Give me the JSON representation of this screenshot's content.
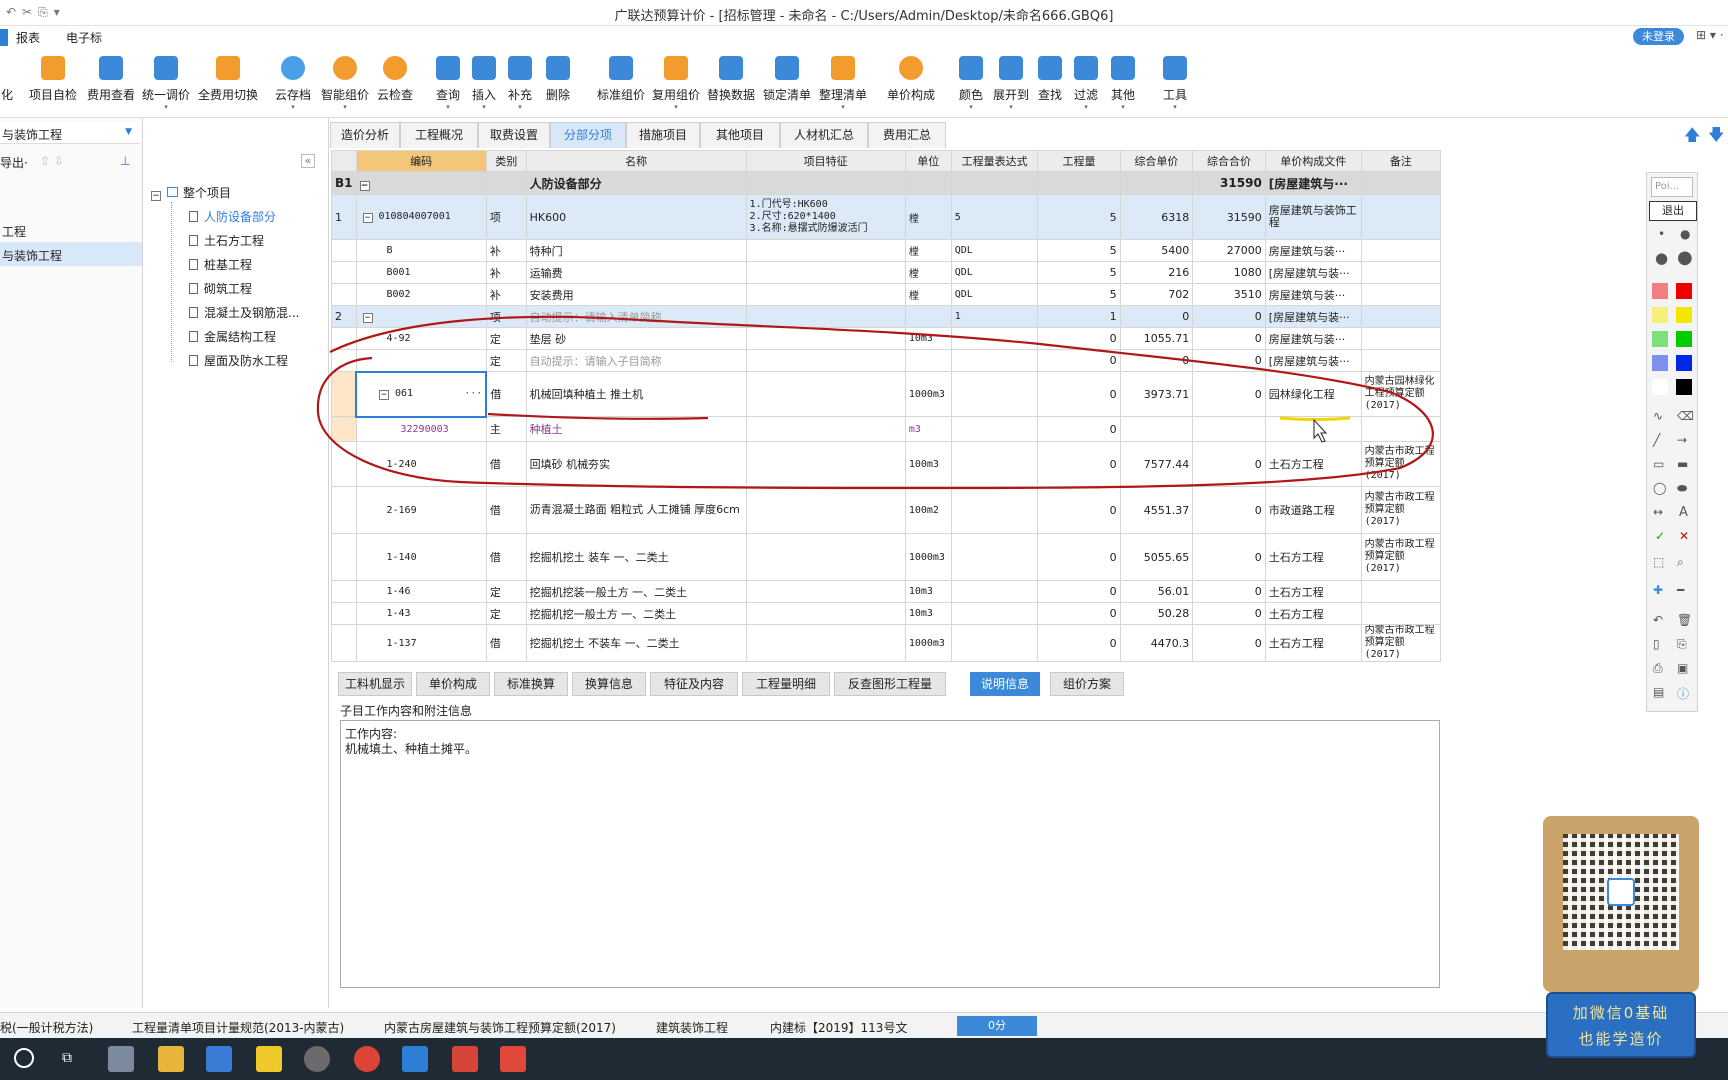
{
  "app": {
    "title": "广联达预算计价 - [招标管理 - 未命名 - C:/Users/Admin/Desktop/未命名666.GBQ6]",
    "login": "未登录"
  },
  "menu": [
    "报表",
    "电子标"
  ],
  "ribbon": [
    "化",
    "项目自检",
    "费用查看",
    "统一调价",
    "全费用切换",
    "云存档",
    "智能组价",
    "云检查",
    "查询",
    "插入",
    "补充",
    "删除",
    "标准组价",
    "复用组价",
    "替换数据",
    "锁定清单",
    "整理清单",
    "单价构成",
    "颜色",
    "展开到",
    "查找",
    "过滤",
    "其他",
    "工具"
  ],
  "left_panel": {
    "selector": "与装饰工程",
    "export": "导出·",
    "items": [
      "工程",
      "与装饰工程"
    ]
  },
  "tree": {
    "root": "整个项目",
    "children": [
      "人防设备部分",
      "土石方工程",
      "桩基工程",
      "砌筑工程",
      "混凝土及钢筋混...",
      "金属结构工程",
      "屋面及防水工程"
    ]
  },
  "tabs": [
    "造价分析",
    "工程概况",
    "取费设置",
    "分部分项",
    "措施项目",
    "其他项目",
    "人材机汇总",
    "费用汇总"
  ],
  "grid": {
    "headers": [
      "编码",
      "类别",
      "名称",
      "项目特征",
      "单位",
      "工程量表达式",
      "工程量",
      "综合单价",
      "综合合价",
      "单价构成文件",
      "备注"
    ],
    "section": {
      "id": "B1",
      "name": "人防设备部分",
      "total": "31590",
      "file": "[房屋建筑与···"
    },
    "rows": [
      {
        "no": "1",
        "code": "010804007001",
        "cat": "项",
        "name": "HK600",
        "feat": "1.门代号:HK600\n2.尺寸:620*1400\n3.名称:悬摆式防爆波活门",
        "unit": "樘",
        "expr": "5",
        "qty": "5",
        "price": "6318",
        "total": "31590",
        "file": "房屋建筑与装饰工程",
        "note": ""
      },
      {
        "no": "",
        "code": "B",
        "cat": "补",
        "name": "特种门",
        "feat": "",
        "unit": "樘",
        "expr": "QDL",
        "qty": "5",
        "price": "5400",
        "total": "27000",
        "file": "房屋建筑与装···",
        "note": ""
      },
      {
        "no": "",
        "code": "B001",
        "cat": "补",
        "name": "运输费",
        "feat": "",
        "unit": "樘",
        "expr": "QDL",
        "qty": "5",
        "price": "216",
        "total": "1080",
        "file": "[房屋建筑与装···",
        "note": ""
      },
      {
        "no": "",
        "code": "B002",
        "cat": "补",
        "name": "安装费用",
        "feat": "",
        "unit": "樘",
        "expr": "QDL",
        "qty": "5",
        "price": "702",
        "total": "3510",
        "file": "房屋建筑与装···",
        "note": ""
      },
      {
        "no": "2",
        "code": "",
        "cat": "项",
        "name": "自动提示：请输入清单简称",
        "feat": "",
        "unit": "",
        "expr": "1",
        "qty": "1",
        "price": "0",
        "total": "0",
        "file": "[房屋建筑与装···",
        "note": ""
      },
      {
        "no": "",
        "code": "4-92",
        "cat": "定",
        "name": "垫层 砂",
        "feat": "",
        "unit": "10m3",
        "expr": "",
        "qty": "0",
        "price": "1055.71",
        "total": "0",
        "file": "房屋建筑与装···",
        "note": ""
      },
      {
        "no": "",
        "code": "",
        "cat": "定",
        "name": "自动提示：请输入子目简称",
        "feat": "",
        "unit": "",
        "expr": "",
        "qty": "0",
        "price": "0",
        "total": "0",
        "file": "[房屋建筑与装···",
        "note": ""
      },
      {
        "no": "",
        "code": "061",
        "cat": "借",
        "name": "机械回填种植土 推土机",
        "feat": "",
        "unit": "1000m3",
        "expr": "",
        "qty": "0",
        "price": "3973.71",
        "total": "0",
        "file": "园林绿化工程",
        "note": "内蒙古园林绿化工程预算定额(2017)"
      },
      {
        "no": "",
        "code": "32290003",
        "cat": "主",
        "name": "种植土",
        "feat": "",
        "unit": "m3",
        "expr": "",
        "qty": "0",
        "price": "",
        "total": "",
        "file": "",
        "note": ""
      },
      {
        "no": "",
        "code": "1-240",
        "cat": "借",
        "name": "回填砂 机械夯实",
        "feat": "",
        "unit": "100m3",
        "expr": "",
        "qty": "0",
        "price": "7577.44",
        "total": "0",
        "file": "土石方工程",
        "note": "内蒙古市政工程预算定额(2017)"
      },
      {
        "no": "",
        "code": "2-169",
        "cat": "借",
        "name": "沥青混凝土路面 粗粒式 人工摊铺 厚度6cm",
        "feat": "",
        "unit": "100m2",
        "expr": "",
        "qty": "0",
        "price": "4551.37",
        "total": "0",
        "file": "市政道路工程",
        "note": "内蒙古市政工程预算定额(2017)"
      },
      {
        "no": "",
        "code": "1-140",
        "cat": "借",
        "name": "挖掘机挖土 装车 一、二类土",
        "feat": "",
        "unit": "1000m3",
        "expr": "",
        "qty": "0",
        "price": "5055.65",
        "total": "0",
        "file": "土石方工程",
        "note": "内蒙古市政工程预算定额(2017)"
      },
      {
        "no": "",
        "code": "1-46",
        "cat": "定",
        "name": "挖掘机挖装一般土方 一、二类土",
        "feat": "",
        "unit": "10m3",
        "expr": "",
        "qty": "0",
        "price": "56.01",
        "total": "0",
        "file": "土石方工程",
        "note": ""
      },
      {
        "no": "",
        "code": "1-43",
        "cat": "定",
        "name": "挖掘机挖一般土方 一、二类土",
        "feat": "",
        "unit": "10m3",
        "expr": "",
        "qty": "0",
        "price": "50.28",
        "total": "0",
        "file": "土石方工程",
        "note": ""
      },
      {
        "no": "",
        "code": "1-137",
        "cat": "借",
        "name": "挖掘机挖土 不装车 一、二类土",
        "feat": "",
        "unit": "1000m3",
        "expr": "",
        "qty": "0",
        "price": "4470.3",
        "total": "0",
        "file": "土石方工程",
        "note": "内蒙古市政工程预算定额(2017)"
      }
    ]
  },
  "bottom_tabs": [
    "工料机显示",
    "单价构成",
    "标准换算",
    "换算信息",
    "特征及内容",
    "工程量明细",
    "反查图形工程量",
    "说明信息",
    "组价方案"
  ],
  "detail": {
    "heading": "子目工作内容和附注信息",
    "line1": "工作内容:",
    "line2": "机械填土、种植土摊平。"
  },
  "status": [
    "税(一般计税方法)",
    "工程量清单项目计量规范(2013-内蒙古)",
    "内蒙古房屋建筑与装饰工程预算定额(2017)",
    "建筑装饰工程",
    "内建标【2019】113号文",
    "0分"
  ],
  "palette": {
    "input_placeholder": "Poi...",
    "exit": "退出"
  },
  "promo": {
    "line1": "加微信0基础",
    "line2": "也能学造价"
  },
  "colors": {
    "accent": "#2f7fd8",
    "annotation": "#b01818",
    "highlight": "#f2d400"
  }
}
